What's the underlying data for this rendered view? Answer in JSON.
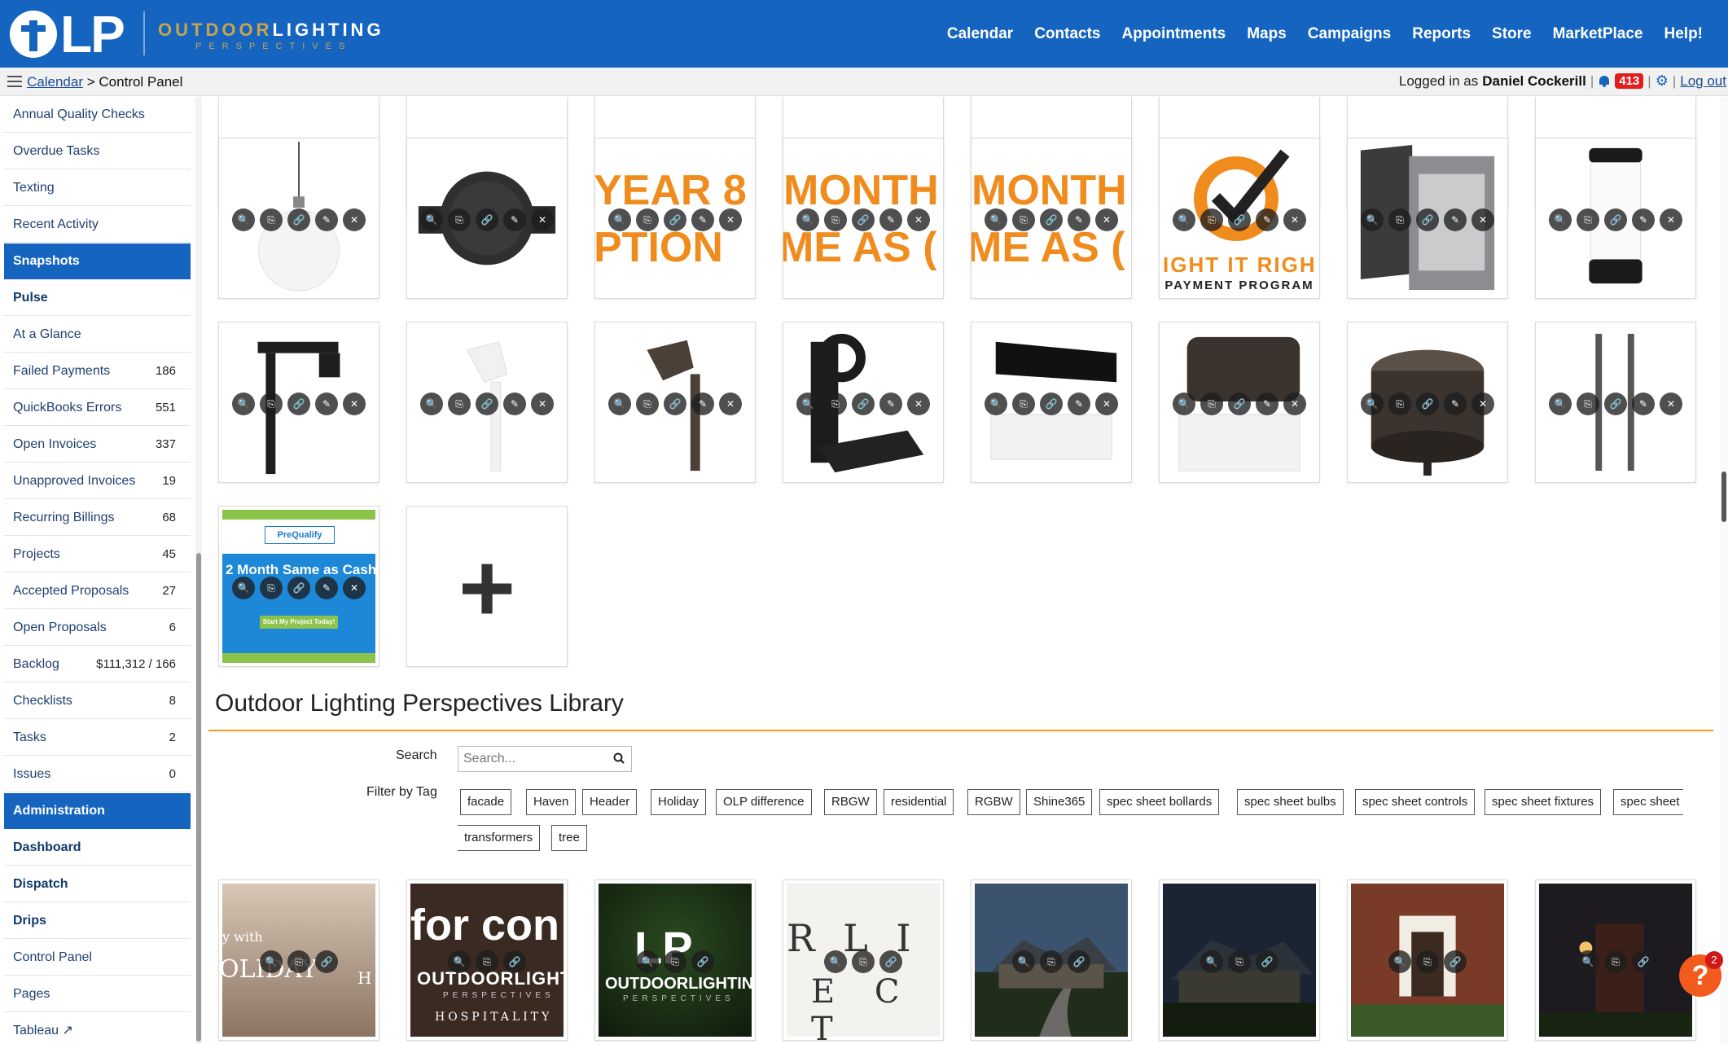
{
  "brand": {
    "logo_letters": "LP",
    "logo_word1a": "OUTDOOR",
    "logo_word1b": "LIGHTING",
    "logo_word2": "PERSPECTIVES"
  },
  "nav": [
    "Calendar",
    "Contacts",
    "Appointments",
    "Maps",
    "Campaigns",
    "Reports",
    "Store",
    "MarketPlace",
    "Help!"
  ],
  "breadcrumb": {
    "link": "Calendar",
    "separator": ">",
    "current": "Control Panel"
  },
  "user": {
    "prefix": "Logged in as",
    "name": "Daniel Cockerill",
    "notifications": "413",
    "logout": "Log out"
  },
  "sidebar": [
    {
      "label": "Annual Quality Checks",
      "count": ""
    },
    {
      "label": "Overdue Tasks",
      "count": ""
    },
    {
      "label": "Texting",
      "count": ""
    },
    {
      "label": "Recent Activity",
      "count": ""
    },
    {
      "label": "Snapshots",
      "count": "",
      "type": "header"
    },
    {
      "label": "Pulse",
      "count": "",
      "type": "bold"
    },
    {
      "label": "At a Glance",
      "count": ""
    },
    {
      "label": "Failed Payments",
      "count": "186"
    },
    {
      "label": "QuickBooks Errors",
      "count": "551"
    },
    {
      "label": "Open Invoices",
      "count": "337"
    },
    {
      "label": "Unapproved Invoices",
      "count": "19"
    },
    {
      "label": "Recurring Billings",
      "count": "68"
    },
    {
      "label": "Projects",
      "count": "45"
    },
    {
      "label": "Accepted Proposals",
      "count": "27"
    },
    {
      "label": "Open Proposals",
      "count": "6"
    },
    {
      "label": "Backlog",
      "count": "$111,312 / 166"
    },
    {
      "label": "Checklists",
      "count": "8"
    },
    {
      "label": "Tasks",
      "count": "2"
    },
    {
      "label": "Issues",
      "count": "0"
    },
    {
      "label": "Administration",
      "count": "",
      "type": "header"
    },
    {
      "label": "Dashboard",
      "count": "",
      "type": "bold"
    },
    {
      "label": "Dispatch",
      "count": "",
      "type": "bold"
    },
    {
      "label": "Drips",
      "count": "",
      "type": "bold"
    },
    {
      "label": "Control Panel",
      "count": ""
    },
    {
      "label": "Pages",
      "count": ""
    },
    {
      "label": "Tableau",
      "count": ""
    }
  ],
  "tile_texts": {
    "year": "YEAR & OPTION",
    "year_l1": "YEAR 8 ",
    "year_l2": "PTION",
    "month_l1": "MONTH",
    "month_l2": "ME AS (",
    "light_l1": "IGHT IT RIGH",
    "light_l2": "PAYMENT PROGRAM",
    "prequalify": "PreQualify",
    "prequalify_cta": "Start My Project Today!",
    "prequalify_main": "2 Month Same as Cash",
    "add_icon": "+"
  },
  "library": {
    "title": "Outdoor Lighting Perspectives Library",
    "search_label": "Search",
    "search_placeholder": "Search...",
    "filter_label": "Filter by Tag",
    "tags": [
      "facade",
      "Haven",
      "Header",
      "Holiday",
      "OLP difference",
      "RBGW",
      "residential",
      "RGBW",
      "Shine365",
      "spec sheet bollards",
      "spec sheet bulbs",
      "spec sheet controls",
      "spec sheet fixtures",
      "spec sheet",
      "transformers",
      "tree"
    ],
    "thumb_texts": {
      "holiday_l1": "y with",
      "holiday_l2": "OLIDAY",
      "holiday_l3": "H",
      "forcon": "for con",
      "hospitality": "HOSPITALITY",
      "ect_l1": "R L I",
      "ect_l2": "E C T"
    }
  },
  "help": {
    "icon": "?",
    "badge": "2"
  }
}
